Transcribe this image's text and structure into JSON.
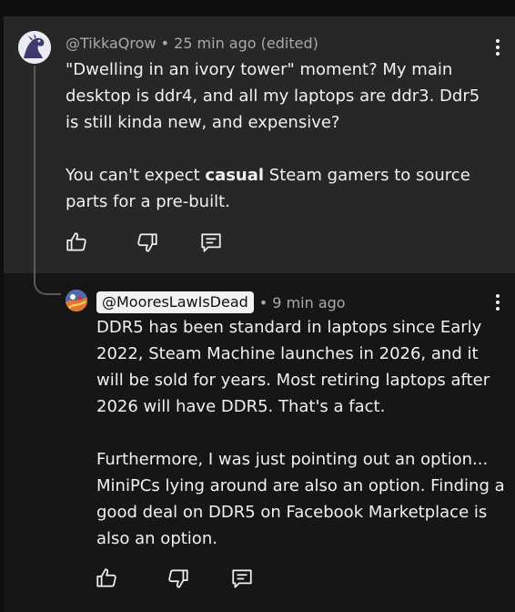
{
  "comment": {
    "author": "@TikkaQrow",
    "meta_suffix": " • 25 min ago (edited)",
    "paragraph1": "\"Dwelling in an ivory tower\" moment? My main desktop is ddr4, and all my laptops are ddr3. Ddr5 is still kinda new, and expensive?",
    "paragraph2_before": "You can't expect ",
    "paragraph2_bold": "casual",
    "paragraph2_after": " Steam gamers to source parts for a pre-built."
  },
  "reply": {
    "author": "@MooresLawIsDead",
    "time": "• 9 min ago",
    "paragraph1": "DDR5 has been standard in laptops since Early 2022, Steam Machine launches in 2026, and it will be sold for years.  Most retiring laptops after 2026 will have DDR5. That's a fact.",
    "paragraph2": "Furthermore, I was just pointing out an option... MiniPCs lying around are also an option.  Finding a good deal on DDR5 on Facebook Marketplace is also an option."
  },
  "icons": {
    "like": "thumb-up-icon",
    "dislike": "thumb-down-icon",
    "reply": "comment-icon",
    "menu": "more-vert-icon"
  },
  "colors": {
    "background": "#0f0f0f",
    "comment_card": "#272727",
    "reply_card": "#161616",
    "text": "#f1f1f1",
    "meta": "#aaaaaa",
    "handle_pill": "#f1f1f1"
  }
}
